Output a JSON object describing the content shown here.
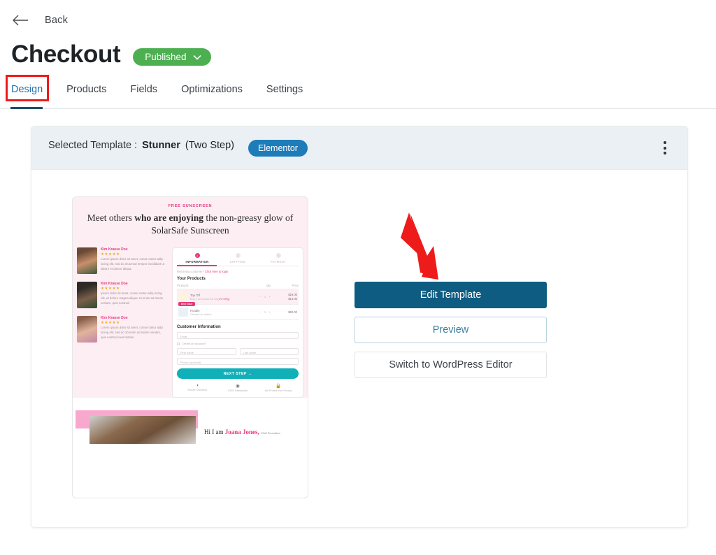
{
  "topbar": {
    "back_label": "Back",
    "back_icon": "arrow-left-icon"
  },
  "header": {
    "title": "Checkout",
    "status": {
      "label": "Published",
      "color": "#4caf50",
      "chevron_icon": "chevron-down-icon"
    }
  },
  "tabs": [
    {
      "label": "Design",
      "active": true
    },
    {
      "label": "Products",
      "active": false
    },
    {
      "label": "Fields",
      "active": false
    },
    {
      "label": "Optimizations",
      "active": false
    },
    {
      "label": "Settings",
      "active": false
    }
  ],
  "card": {
    "header": {
      "selected_label": "Selected Template :",
      "template_name": "Stunner",
      "template_variant": "(Two Step)",
      "builder_badge": "Elementor",
      "builder_badge_color": "#1e7cb8",
      "menu_icon": "kebab-menu-icon"
    },
    "actions": {
      "edit_template": "Edit Template",
      "preview": "Preview",
      "switch_editor": "Switch to WordPress Editor",
      "primary_color": "#0e5c82",
      "annotation_arrow_color": "#ee1b1b"
    }
  },
  "thumbnail": {
    "eyebrow": "FREE SUNSCREEN",
    "heading_part1": "Meet others ",
    "heading_bold": "who are enjoying",
    "heading_part2": " the non-greasy glow of SolarSafe Sunscreen",
    "reviews": [
      {
        "name": "Kim Krause Doe",
        "stars": "★★★★★",
        "text": "Lorem ipsum dolor sit amet, conse ctetur adip iscing elit, sed do eiusmod tempor incididunt ut labore et dolore aliqua."
      },
      {
        "name": "Kim Krause Doe",
        "stars": "★★★★★",
        "text": "Ipsum dolor sit amet, conse ctetur adip iscing elit, et dolore magna aliqua. Ut enim ad minim veniam, quis nostrud."
      },
      {
        "name": "Kim Krause Doe",
        "stars": "★★★★★",
        "text": "Lorem ipsum dolor sit amet, conse ctetur adip iscing elit, sed do 10 enim ad minim veniam, quis nostrud exercitation."
      }
    ],
    "steps": [
      {
        "num": "1",
        "label": "INFORMATION",
        "active": true
      },
      {
        "num": "2",
        "label": "SHIPPING",
        "active": false
      },
      {
        "num": "3",
        "label": "PAYMENT",
        "active": false
      }
    ],
    "returning_text": "Returning customer?",
    "returning_link": "Click here to login",
    "products_title": "Your Products",
    "table_headers": {
      "product": "Products",
      "qty": "Qty",
      "price": "Price"
    },
    "products": [
      {
        "name": "Top Off",
        "sub": "Buy 1 and Save $2.00",
        "sub_link": "(1% Off)g",
        "qty": "1",
        "price_old": "$19.00",
        "price": "$14.00",
        "tag": "",
        "selected": true
      },
      {
        "name": "Hoodie",
        "sub": "Choose an option",
        "sub_link": "",
        "qty": "1",
        "price": "$60.00",
        "tag": "Best Value",
        "selected": false
      }
    ],
    "customer_title": "Customer Information",
    "fields": {
      "email": "Email",
      "create_account": "Create an account?",
      "first_name": "First name",
      "last_name": "Last name",
      "phone": "Phone (optional)"
    },
    "next_button": "NEXT STEP →",
    "trust": [
      {
        "icon": "shield-icon",
        "glyph": "◑",
        "label": "Secure Checkout"
      },
      {
        "icon": "check-badge-icon",
        "glyph": "◉",
        "label": "100% Satisfaction"
      },
      {
        "icon": "lock-icon",
        "glyph": "🔒",
        "label": "We Protect Your Privacy"
      }
    ],
    "signature_prefix": "Hi I am ",
    "signature_name": "Joana Jones,",
    "signature_role": "Chief Formulator"
  }
}
